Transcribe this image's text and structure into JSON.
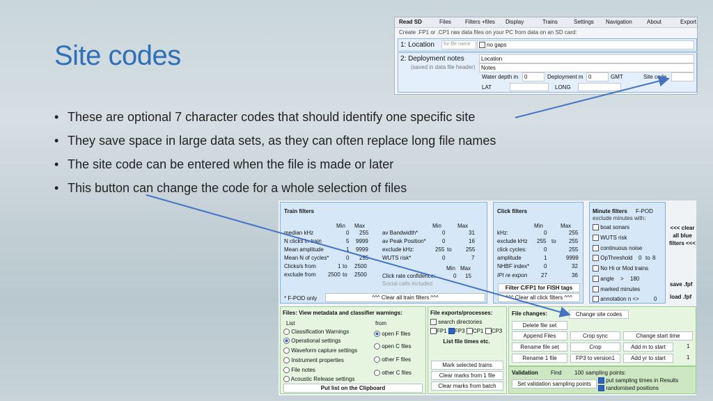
{
  "slide": {
    "title": "Site codes",
    "bullets": [
      "These are optional 7 character codes that should identify one specific site",
      "They save space in large data sets, as they can often replace long file names",
      "The site code can be entered when the file is made or later",
      "This button can change the code for a whole selection of files"
    ]
  },
  "topshot": {
    "menu": [
      "Read SD",
      "Files",
      "Filters +files",
      "Display",
      "Trains",
      "Settings",
      "Navigation",
      "About",
      "Export"
    ],
    "subtitle": "Create .FP1 or .CP1 raw data files on your PC from data on an SD card:",
    "location_label": "1:  Location",
    "location_placeholder": "for file name",
    "no_gaps": "no gaps",
    "deploy_label": "2:  Deployment notes",
    "deploy_sub": "(saved in data  file header)",
    "location2": "Location",
    "notes": "Notes",
    "water_depth": "Water depth m",
    "water_depth_val": "0",
    "deployment_m": "Deployment m",
    "deployment_m_val": "0",
    "gmt": "GMT",
    "site_code": "Site code",
    "lat": "LAT",
    "long": "LONG"
  },
  "train": {
    "title": "Train filters",
    "min": "Min",
    "max": "Max",
    "rows_left": [
      {
        "label": "median kHz",
        "min": "0",
        "max": "255"
      },
      {
        "label": "N clicks in train",
        "min": "5",
        "max": "9999"
      },
      {
        "label": "Mean amplitude",
        "min": "1",
        "max": "9999"
      },
      {
        "label": "Mean N of cycles*",
        "min": "0",
        "max": "255"
      },
      {
        "label": "Clicks/s from",
        "min": "1",
        "to": "to",
        "max": "2500"
      },
      {
        "label": "exclude from",
        "min": "2500",
        "to": "to",
        "max": "2500"
      }
    ],
    "rows_right": [
      {
        "label": "av Bandwidth*",
        "min": "0",
        "max": "31"
      },
      {
        "label": "av Peak Position*",
        "min": "0",
        "max": "16"
      },
      {
        "label": "exclude kHz:",
        "min": "255",
        "to": "to",
        "max": "255"
      },
      {
        "label": "WUTS risk*",
        "min": "0",
        "max": "7"
      }
    ],
    "conf_label": "Click rate confidence:",
    "conf_min": "0",
    "conf_max": "15",
    "social": "Social calls included",
    "fpod_only": "* F-POD only",
    "clear": "^^^ Clear all train filters ^^^"
  },
  "click": {
    "title": "Click filters",
    "rows": [
      {
        "label": "kHz:",
        "min": "0",
        "max": "255"
      },
      {
        "label": "exclude kHz",
        "min": "255",
        "to": "to",
        "max": "255"
      },
      {
        "label": "click cycles:",
        "min": "0",
        "max": "255"
      },
      {
        "label": "amplitude",
        "min": "1",
        "max": "9999"
      },
      {
        "label": "NHBF index*",
        "min": "0",
        "max": "32"
      },
      {
        "label": "IPI re expon",
        "min": "27",
        "max": "36"
      }
    ],
    "fish": "Filter C/FP1 for FISH tags",
    "clear": "^^^ Clear all click filters ^^^"
  },
  "minute": {
    "title": "Minute filters",
    "fpod": "F-POD",
    "exclude": "exclude minutes with:",
    "items": [
      "boat sonars",
      "WUTS risk",
      "continuous noise",
      "OpThreshold",
      "No Hi or Mod trains",
      "angle",
      "marked minutes",
      "annotation n <>"
    ],
    "op_val": "0",
    "op_to": "to",
    "op_max": "8",
    "angle_gt": ">",
    "angle_val": "180",
    "annot_val": "0",
    "clear_all": "<<< clear all blue filters <<<",
    "save": "save .fpf",
    "load": "load .fpf"
  },
  "files_view": {
    "title": "Files: View metadata and classifier warnings:",
    "list": "List",
    "from": "from",
    "options": [
      "Classification Warnings",
      "Operational settings",
      "Waveform capture settings",
      "Instrument properties",
      "File notes",
      "Acoustic Release settings"
    ],
    "from_options": [
      "open F files",
      "open C files",
      "other F files",
      "other C files"
    ],
    "put_list": "Put list on the Clipboard"
  },
  "exports": {
    "title": "File exports/processes:",
    "search": "search directories",
    "types": [
      "FP1",
      "FP3",
      "CP1",
      "CP3"
    ],
    "list_times": "List file times etc.",
    "mark": "Mark selected trains",
    "clear1": "Clear marks from 1 file",
    "clear_batch": "Clear marks from batch"
  },
  "changes": {
    "title": "File changes:",
    "change_site": "Change site codes",
    "delete": "Delete file set",
    "append": "Append Files",
    "crop_sync": "Crop sync",
    "change_start": "Change start time",
    "rename_set": "Rename file set",
    "crop": "Crop",
    "add_m": "Add m to start",
    "add_m_val": "1",
    "rename1": "Rename 1 file",
    "fp3": "FP3 to version1",
    "add_yr": "Add yr to start",
    "add_yr_val": "1"
  },
  "validation": {
    "title": "Validation",
    "find": "Find",
    "find_val": "100",
    "points": "sampling points:",
    "set": "Set validation sampling points",
    "put_times": "put sampling times in Results",
    "randomised": "randomised positions"
  }
}
